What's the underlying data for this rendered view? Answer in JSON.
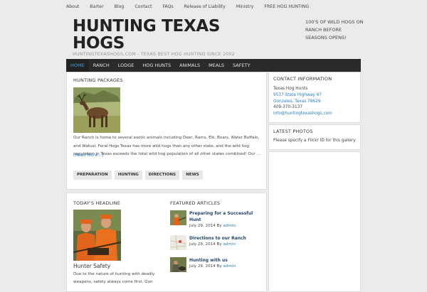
{
  "top_nav": [
    "About",
    "Barter",
    "Blog",
    "Contact",
    "FAQs",
    "Release of Liability",
    "Ministry",
    "FREE HOG HUNTING"
  ],
  "site": {
    "title": "HUNTING TEXAS HOGS",
    "tagline": "HUNTINGTEXASHOGS.COM - TEXAS BEST HOG HUNTING SINCE 2002"
  },
  "header_promo": "100'S OF WILD HOGS ON RANCH BEFORE SEASONS OPENS!",
  "main_nav": {
    "items": [
      "HOME",
      "RANCH",
      "LODGE",
      "HOG HUNTS",
      "ANIMALS",
      "MEALS",
      "SAFETY"
    ],
    "active": "HOME"
  },
  "hunting_packages": {
    "title": "HUNTING PACKAGES",
    "body": "Our Ranch is home to several exotic animals including Deer, Rams, Elk, Boars, Water Buffalo, and Watusi.   Feral Hogs Texas has more wild hogs than any other state, and the wild hog population in Texas exceeds the total wild hog population of all other states combined!  Our ...",
    "read_more": "[Read More...]",
    "tags": [
      "PREPARATION",
      "HUNTING",
      "DIRECTIONS",
      "NEWS"
    ]
  },
  "todays_headline": {
    "title": "TODAY'S HEADLINE",
    "post_title": "Hunter Safety",
    "excerpt": "Due to the nature of hunting with deadly weapons, safety always come first. Gun"
  },
  "featured": {
    "title": "FEATURED ARTICLES",
    "articles": [
      {
        "title": "Preparing for a Successful Hunt",
        "date": "July 29, 2014 By",
        "author": "admin"
      },
      {
        "title": "Directions to our Ranch",
        "date": "July 29, 2014 By",
        "author": "admin"
      },
      {
        "title": "Hunting with us",
        "date": "July 29, 2014 By",
        "author": "admin"
      }
    ]
  },
  "contact": {
    "title": "CONTACT INFORMATION",
    "name": "Texas Hog Hunts",
    "address1": "9537 State Highway 97",
    "address2": "Gonzales, Texas 78629",
    "phone": "409-370-3137",
    "email": "info@huntingtexashogs.com"
  },
  "latest_photos": {
    "title": "LATEST PHOTOS",
    "message": "Please specify a Flickr ID for this gallery"
  }
}
